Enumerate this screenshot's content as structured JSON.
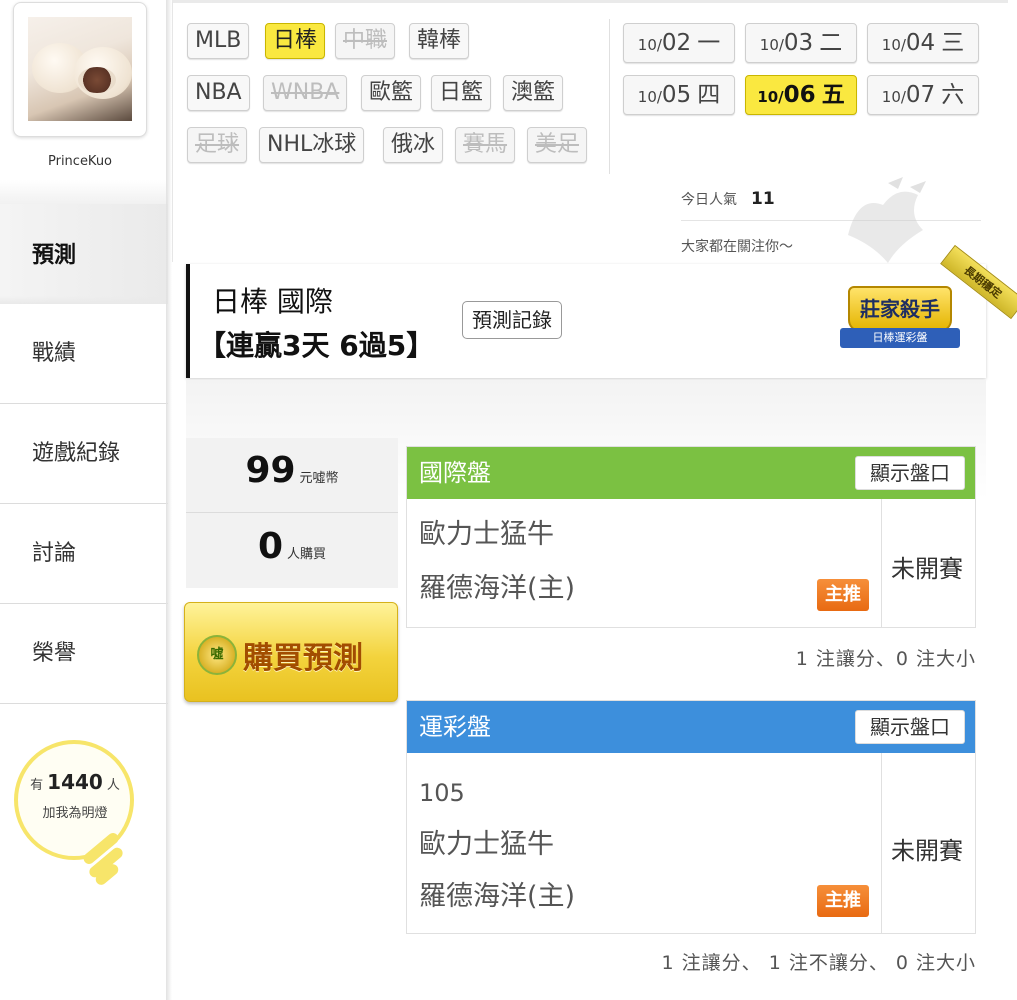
{
  "user": {
    "name": "PrinceKuo"
  },
  "nav": {
    "items": [
      {
        "label": "預測",
        "active": true
      },
      {
        "label": "戰績"
      },
      {
        "label": "遊戲紀錄"
      },
      {
        "label": "討論"
      },
      {
        "label": "榮譽"
      }
    ]
  },
  "fans": {
    "prefix": "有",
    "count": "1440",
    "suffix": "人",
    "line2": "加我為明燈"
  },
  "leagues": [
    {
      "label": "MLB",
      "state": "normal"
    },
    {
      "label": "日棒",
      "state": "selected"
    },
    {
      "label": "中職",
      "state": "disabled"
    },
    {
      "label": "韓棒",
      "state": "normal"
    },
    {
      "label": "NBA",
      "state": "normal"
    },
    {
      "label": "WNBA",
      "state": "disabled"
    },
    {
      "label": "歐籃",
      "state": "normal"
    },
    {
      "label": "日籃",
      "state": "normal"
    },
    {
      "label": "澳籃",
      "state": "normal"
    },
    {
      "label": "足球",
      "state": "disabled"
    },
    {
      "label": "NHL冰球",
      "state": "normal"
    },
    {
      "label": "俄冰",
      "state": "normal"
    },
    {
      "label": "賽馬",
      "state": "disabled"
    },
    {
      "label": "美足",
      "state": "disabled"
    }
  ],
  "dates": [
    {
      "md": "10/",
      "d": "02",
      "wd": "一",
      "selected": false
    },
    {
      "md": "10/",
      "d": "03",
      "wd": "二",
      "selected": false
    },
    {
      "md": "10/",
      "d": "04",
      "wd": "三",
      "selected": false
    },
    {
      "md": "10/",
      "d": "05",
      "wd": "四",
      "selected": false
    },
    {
      "md": "10/",
      "d": "06",
      "wd": "五",
      "selected": true
    },
    {
      "md": "10/",
      "d": "07",
      "wd": "六",
      "selected": false
    }
  ],
  "popularity": {
    "label": "今日人氣",
    "value": "11",
    "attention": "大家都在關注你～"
  },
  "prediction": {
    "league": "日棒 國際",
    "streak": "【連贏3天 6過5】",
    "record_button": "預測記錄",
    "badge_title": "莊家殺手",
    "badge_sub": "日棒運彩盤",
    "sash": "長期穩定"
  },
  "stats": {
    "price": "99",
    "price_unit": "元噓幣",
    "buyers": "0",
    "buyers_unit": "人購買"
  },
  "buy_button": {
    "icon": "噓",
    "label": "購買預測"
  },
  "cards": [
    {
      "title": "國際盤",
      "color": "#7bc142",
      "show_button": "顯示盤口",
      "code": "",
      "away": "歐力士猛牛",
      "home": "羅德海洋(主)",
      "status": "未開賽",
      "pick": "主推",
      "summary": "1 注讓分、0 注大小"
    },
    {
      "title": "運彩盤",
      "color": "#3d8fdc",
      "show_button": "顯示盤口",
      "code": "105",
      "away": "歐力士猛牛",
      "home": "羅德海洋(主)",
      "status": "未開賽",
      "pick": "主推",
      "summary": "1 注讓分、 1 注不讓分、 0 注大小"
    }
  ]
}
